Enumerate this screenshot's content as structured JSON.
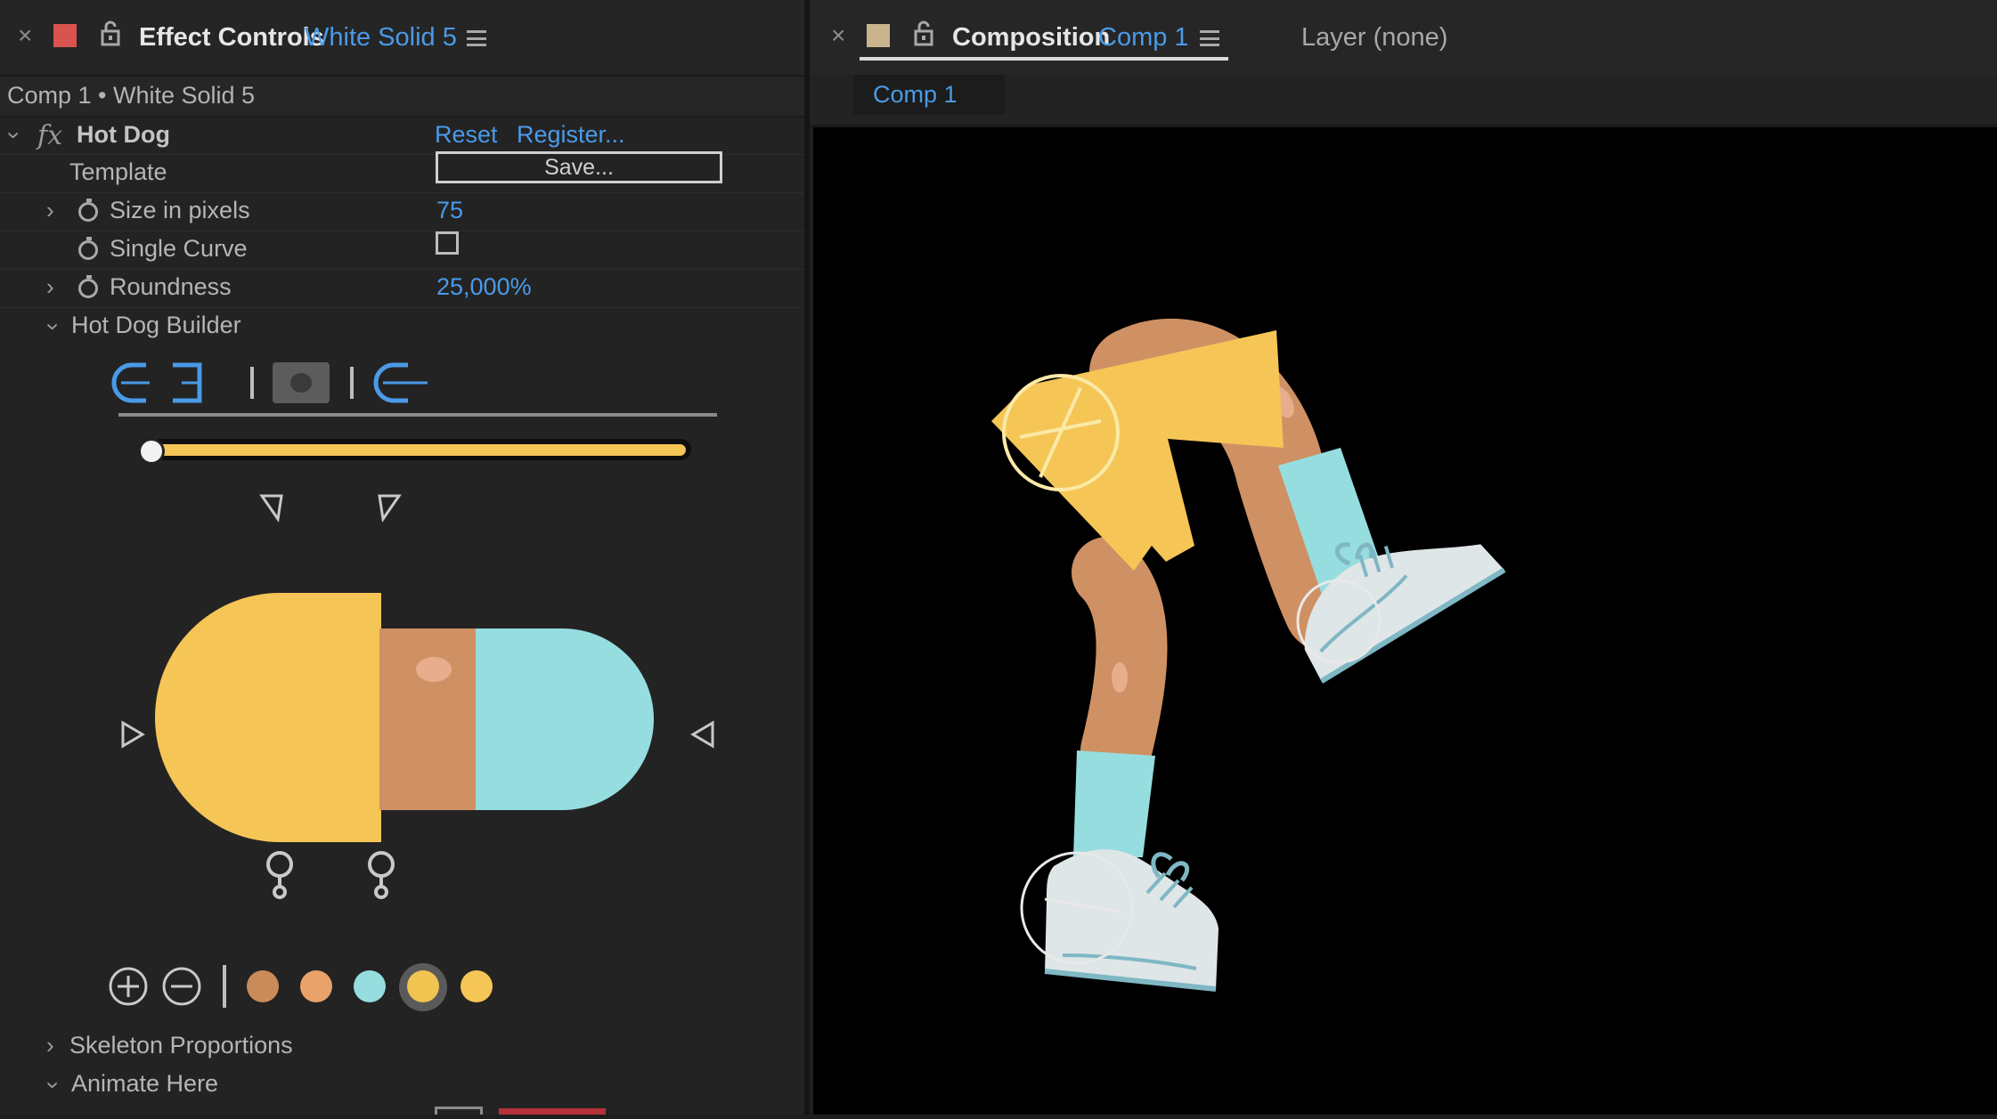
{
  "effect_controls": {
    "header": {
      "close": "×",
      "title": "Effect Controls",
      "layer_name": "White Solid 5",
      "label_color": "#d9534f"
    },
    "breadcrumb": "Comp 1 • White Solid 5",
    "effect": {
      "fx": "fx",
      "name": "Hot Dog",
      "reset": "Reset",
      "register": "Register..."
    },
    "template": {
      "label": "Template",
      "button": "Save..."
    },
    "size": {
      "label": "Size in pixels",
      "value": "75"
    },
    "single_curve": {
      "label": "Single Curve",
      "checked": false
    },
    "roundness": {
      "label": "Roundness",
      "value": "25,000%"
    },
    "builder": {
      "label": "Hot Dog Builder",
      "slider_fraction": 0.0,
      "swatches": [
        "#c98b59",
        "#e8a26a",
        "#96dde0",
        "#f0c450",
        "#f5c556"
      ],
      "selected_swatch": 3
    },
    "skeleton": {
      "label": "Skeleton Proportions"
    },
    "animate": {
      "label": "Animate Here"
    }
  },
  "composition": {
    "header": {
      "close": "×",
      "title": "Composition",
      "comp_name": "Comp 1",
      "layer_label": "Layer (none)",
      "label_color": "#c9b48e"
    },
    "tab": "Comp 1"
  },
  "colors": {
    "accent_blue": "#4a9ae8",
    "yellow": "#f5c556",
    "skin": "#cf9164",
    "cyan": "#96dde0",
    "shoe": "#dfe6e7"
  }
}
